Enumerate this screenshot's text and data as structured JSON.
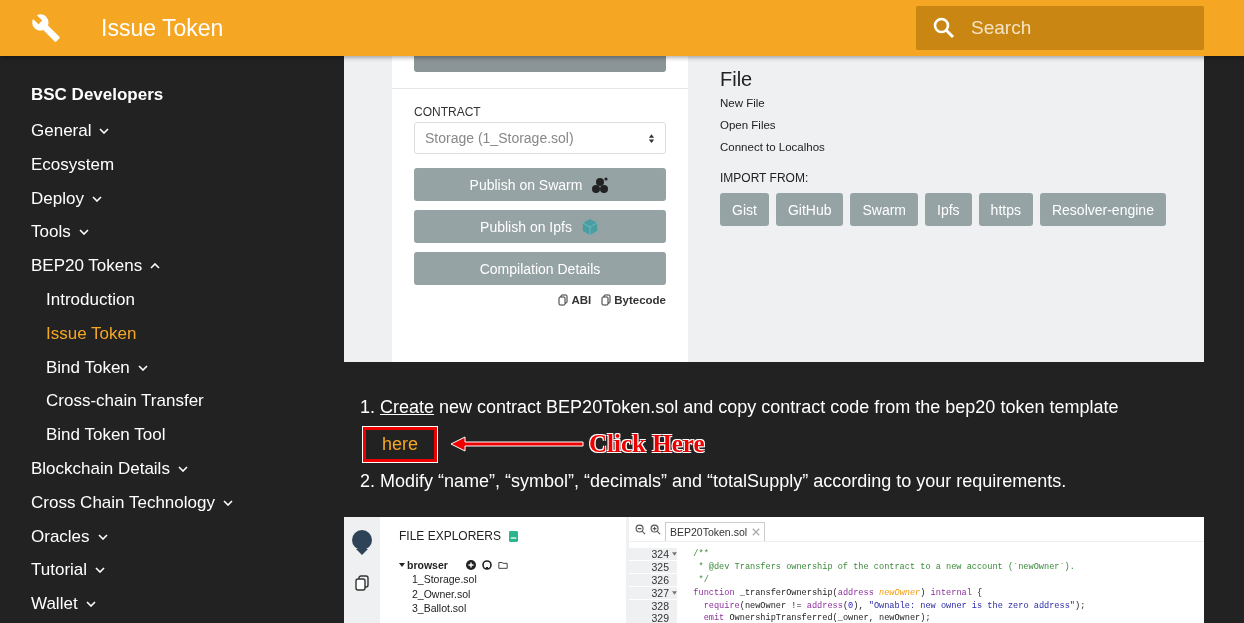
{
  "header": {
    "title": "Issue Token",
    "search": {
      "placeholder": "Search"
    }
  },
  "sidebar": {
    "title": "BSC Developers",
    "items": [
      {
        "label": "General",
        "expanded": false,
        "selected": false
      },
      {
        "label": "Ecosystem",
        "selected": false
      },
      {
        "label": "Deploy",
        "expanded": false,
        "selected": false
      },
      {
        "label": "Tools",
        "expanded": false,
        "selected": false
      },
      {
        "label": "BEP20 Tokens",
        "expanded": true,
        "selected": false,
        "children": [
          {
            "label": "Introduction",
            "selected": false
          },
          {
            "label": "Issue Token",
            "selected": true
          },
          {
            "label": "Bind Token",
            "expanded": false,
            "selected": false
          },
          {
            "label": "Cross-chain Transfer",
            "selected": false
          },
          {
            "label": "Bind Token Tool",
            "selected": false
          }
        ]
      },
      {
        "label": "Blockchain Details",
        "expanded": false,
        "selected": false
      },
      {
        "label": "Cross Chain Technology",
        "expanded": false,
        "selected": false
      },
      {
        "label": "Oracles",
        "expanded": false,
        "selected": false
      },
      {
        "label": "Tutorial",
        "expanded": false,
        "selected": false
      },
      {
        "label": "Wallet",
        "expanded": false,
        "selected": false
      }
    ]
  },
  "screenshot_top": {
    "contract_label": "CONTRACT",
    "contract_value": "Storage (1_Storage.sol)",
    "buttons": [
      {
        "label": "Publish on Swarm",
        "kind": "swarm"
      },
      {
        "label": "Publish on Ipfs",
        "kind": "ipfs"
      },
      {
        "label": "Compilation Details",
        "kind": "plain"
      }
    ],
    "copy_links": [
      "ABI",
      "Bytecode"
    ],
    "file_title": "File",
    "file_links": [
      "New File",
      "Open Files",
      "Connect to Localhos"
    ],
    "import_label": "IMPORT FROM:",
    "import_buttons": [
      "Gist",
      "GitHub",
      "Swarm",
      "Ipfs",
      "https",
      "Resolver-engine"
    ]
  },
  "steps": [
    {
      "number": "1.",
      "text": "Create new contract BEP20Token.sol and copy contract code from the bep20 token template",
      "link": "here"
    },
    {
      "number": "2.",
      "text": "Modify “name”, “symbol”, “decimals” and “totalSupply” according to your requirements."
    }
  ],
  "annotation": {
    "label": "Click Here"
  },
  "screenshot_bottom": {
    "explorer_title": "FILE EXPLORERS",
    "folder": "browser",
    "files": [
      "1_Storage.sol",
      "2_Owner.sol",
      "3_Ballot.sol"
    ],
    "tab": "BEP20Token.sol",
    "lines": [
      {
        "num": "324",
        "fold": true,
        "tokens": [
          {
            "kind": "comment",
            "text": "  /**"
          }
        ]
      },
      {
        "num": "325",
        "fold": false,
        "tokens": [
          {
            "kind": "comment",
            "text": "   * @dev Transfers ownership of the contract to a new account (`newOwner`)."
          }
        ]
      },
      {
        "num": "326",
        "fold": false,
        "tokens": [
          {
            "kind": "comment",
            "text": "   */"
          }
        ]
      },
      {
        "num": "327",
        "fold": true,
        "tokens": [
          {
            "kind": "keyword",
            "text": "  function "
          },
          {
            "kind": "plain",
            "text": "_transferOwnership("
          },
          {
            "kind": "keyword",
            "text": "address "
          },
          {
            "kind": "param",
            "text": "newOwner"
          },
          {
            "kind": "plain",
            "text": ") "
          },
          {
            "kind": "keyword",
            "text": "internal "
          },
          {
            "kind": "plain",
            "text": "{"
          }
        ]
      },
      {
        "num": "328",
        "fold": false,
        "tokens": [
          {
            "kind": "keyword",
            "text": "    require"
          },
          {
            "kind": "plain",
            "text": "(newOwner != "
          },
          {
            "kind": "keyword",
            "text": "address"
          },
          {
            "kind": "plain",
            "text": "("
          },
          {
            "kind": "number",
            "text": "0"
          },
          {
            "kind": "plain",
            "text": "), "
          },
          {
            "kind": "string",
            "text": "\"Ownable: new owner is the zero address\""
          },
          {
            "kind": "plain",
            "text": ");"
          }
        ]
      },
      {
        "num": "329",
        "fold": false,
        "tokens": [
          {
            "kind": "keyword",
            "text": "    emit "
          },
          {
            "kind": "plain",
            "text": "OwnershipTransferred(_owner, newOwner);"
          }
        ]
      }
    ]
  }
}
